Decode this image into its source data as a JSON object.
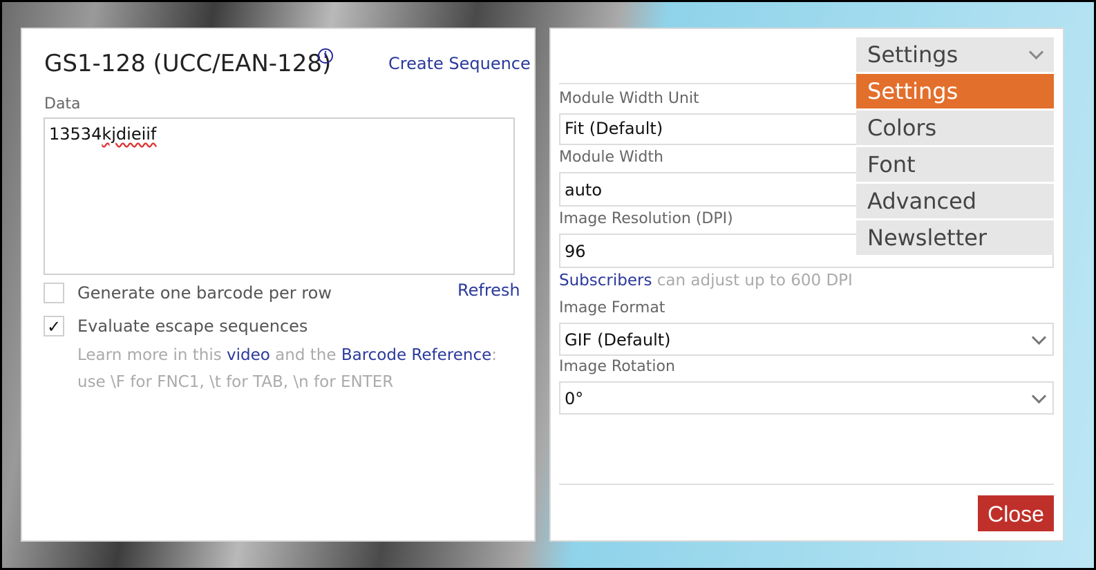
{
  "left": {
    "title": "GS1-128 (UCC/EAN-128)",
    "info_icon": "info-icon",
    "create_sequence": "Create Sequence",
    "data_label": "Data",
    "data_value_prefix": "13534",
    "data_value_misspelled": "kjdieiif",
    "per_row_label": "Generate one barcode per row",
    "refresh": "Refresh",
    "escape_label": "Evaluate escape sequences",
    "escape_checked_mark": "✓",
    "help_1": "Learn more in this ",
    "help_video": "video",
    "help_2": " and the ",
    "help_reference": "Barcode Reference",
    "help_3": ": use \\F for FNC1, \\t for TAB, \\n for ENTER"
  },
  "right": {
    "dropdown": {
      "selected": "Settings",
      "options": [
        "Settings",
        "Colors",
        "Font",
        "Advanced",
        "Newsletter"
      ]
    },
    "module_width_unit_label": "Module Width Unit",
    "module_width_unit_value": "Fit (Default)",
    "module_width_label": "Module Width",
    "module_width_value": "auto",
    "dpi_label": "Image Resolution (DPI)",
    "dpi_value": "96",
    "subscribers_link": "Subscribers",
    "subscribers_note": " can adjust up to 600 DPI",
    "format_label": "Image Format",
    "format_value": "GIF (Default)",
    "rotation_label": "Image Rotation",
    "rotation_value": "0°",
    "close": "Close"
  },
  "colors": {
    "accent_orange": "#e36f2c",
    "close_red": "#c0302a",
    "link_blue": "#2b3a9c"
  }
}
